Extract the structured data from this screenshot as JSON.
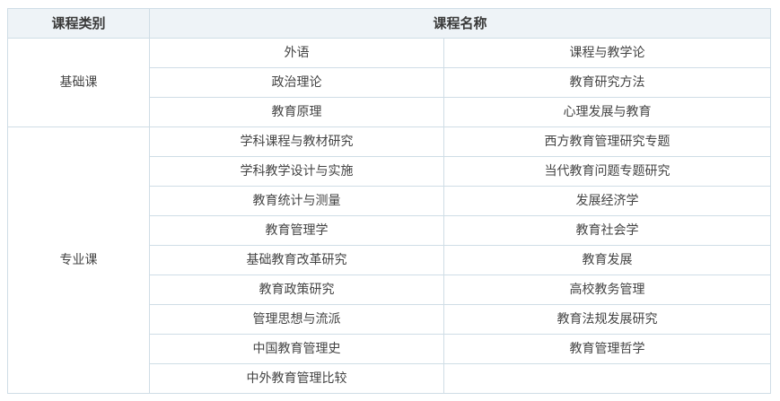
{
  "table": {
    "header": {
      "category": "课程类别",
      "name": "课程名称"
    },
    "groups": [
      {
        "category": "基础课",
        "rows": [
          [
            "外语",
            "课程与教学论"
          ],
          [
            "政治理论",
            "教育研究方法"
          ],
          [
            "教育原理",
            "心理发展与教育"
          ]
        ]
      },
      {
        "category": "专业课",
        "rows": [
          [
            "学科课程与教材研究",
            "西方教育管理研究专题"
          ],
          [
            "学科教学设计与实施",
            "当代教育问题专题研究"
          ],
          [
            "教育统计与测量",
            "发展经济学"
          ],
          [
            "教育管理学",
            "教育社会学"
          ],
          [
            "基础教育改革研究",
            "教育发展"
          ],
          [
            "教育政策研究",
            "高校教务管理"
          ],
          [
            "管理思想与流派",
            "教育法规发展研究"
          ],
          [
            "中国教育管理史",
            "教育管理哲学"
          ],
          [
            "中外教育管理比较",
            ""
          ]
        ]
      }
    ]
  }
}
